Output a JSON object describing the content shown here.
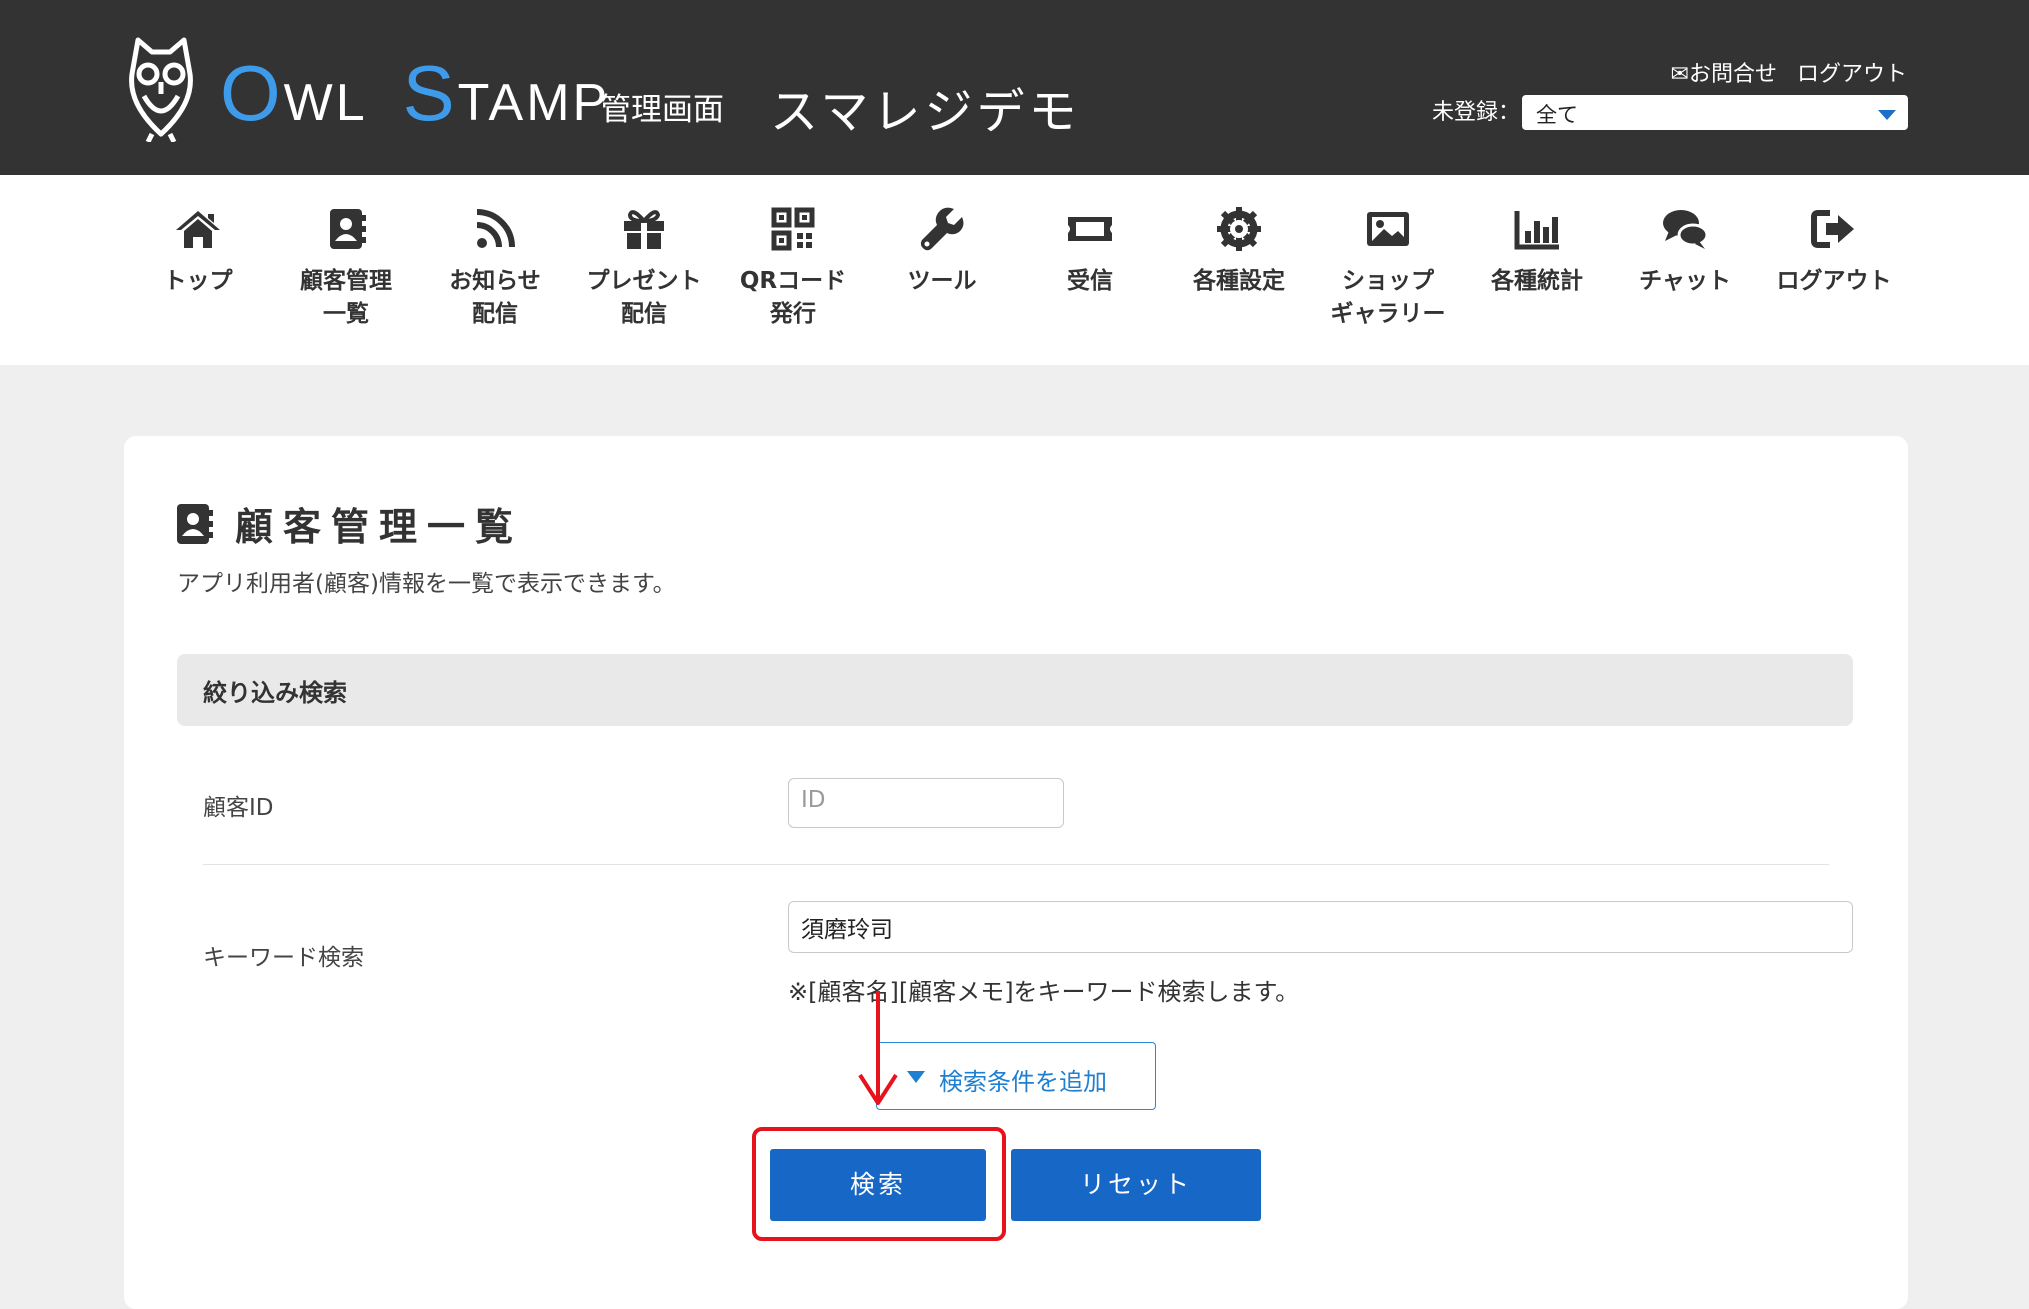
{
  "header": {
    "logo_text_1_cap": "O",
    "logo_text_1_rest": "WL",
    "logo_text_2_cap": "S",
    "logo_text_2_rest": "TAMP",
    "admin_label": "管理画面",
    "shop_name": "スマレジデモ",
    "contact_link": "✉お問合せ",
    "logout_link": "ログアウト",
    "unregistered_label": "未登録：",
    "unregistered_selected": "全て"
  },
  "nav": {
    "items": [
      {
        "label": "トップ",
        "icon": "home-icon"
      },
      {
        "label": "顧客管理\n一覧",
        "icon": "address-book-icon"
      },
      {
        "label": "お知らせ\n配信",
        "icon": "rss-icon"
      },
      {
        "label": "プレゼント\n配信",
        "icon": "gift-icon"
      },
      {
        "label": "QRコード\n発行",
        "icon": "qrcode-icon"
      },
      {
        "label": "ツール",
        "icon": "wrench-icon"
      },
      {
        "label": "受信",
        "icon": "ticket-icon"
      },
      {
        "label": "各種設定",
        "icon": "cog-icon"
      },
      {
        "label": "ショップ\nギャラリー",
        "icon": "image-icon"
      },
      {
        "label": "各種統計",
        "icon": "bar-chart-icon"
      },
      {
        "label": "チャット",
        "icon": "comments-icon"
      },
      {
        "label": "ログアウト",
        "icon": "sign-out-icon"
      }
    ]
  },
  "main": {
    "title": "顧客管理一覧",
    "description": "アプリ利用者(顧客)情報を一覧で表示できます。",
    "filter_title": "絞り込み検索",
    "customer_id_label": "顧客ID",
    "customer_id_placeholder": "ID",
    "keyword_label": "キーワード検索",
    "keyword_value": "須磨玲司",
    "keyword_hint": "※[顧客名][顧客メモ]をキーワード検索します。",
    "add_condition_label": "検索条件を追加",
    "search_button": "検索",
    "reset_button": "リセット"
  },
  "colors": {
    "header_bg": "#333333",
    "accent_blue": "#1767c6",
    "logo_blue": "#3e9be9",
    "highlight_red": "#e6121c"
  }
}
